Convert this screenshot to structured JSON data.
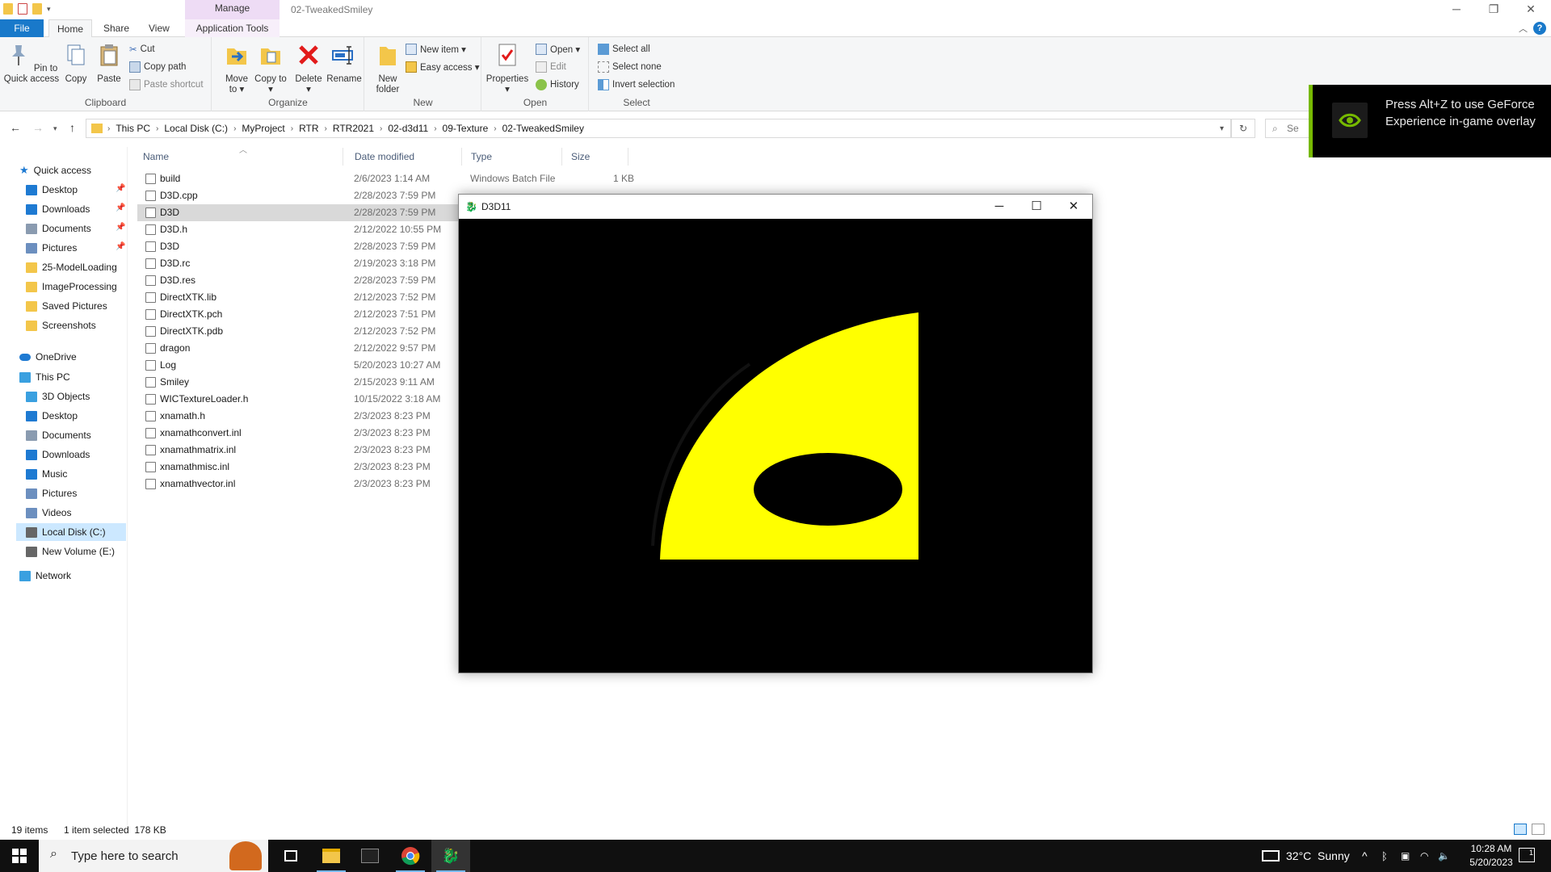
{
  "titlebar": {
    "manage_label": "Manage",
    "window_title": "02-TweakedSmiley",
    "minimize": "─",
    "restore": "❐",
    "close": "✕"
  },
  "ribbon_tabs": {
    "file": "File",
    "home": "Home",
    "share": "Share",
    "view": "View",
    "app_tools": "Application Tools"
  },
  "ribbon": {
    "clipboard": {
      "label": "Clipboard",
      "pin": "Pin to Quick access",
      "copy": "Copy",
      "paste": "Paste",
      "cut": "Cut",
      "copy_path": "Copy path",
      "paste_shortcut": "Paste shortcut"
    },
    "organize": {
      "label": "Organize",
      "move_to": "Move to ▾",
      "copy_to": "Copy to ▾",
      "delete": "Delete ▾",
      "rename": "Rename"
    },
    "new": {
      "label": "New",
      "new_folder": "New folder",
      "new_item": "New item ▾",
      "easy_access": "Easy access ▾"
    },
    "open": {
      "label": "Open",
      "properties": "Properties ▾",
      "open": "Open ▾",
      "edit": "Edit",
      "history": "History"
    },
    "select": {
      "label": "Select",
      "select_all": "Select all",
      "select_none": "Select none",
      "invert": "Invert selection"
    }
  },
  "address": {
    "crumbs": [
      "This PC",
      "Local Disk (C:)",
      "MyProject",
      "RTR",
      "RTR2021",
      "02-d3d11",
      "09-Texture",
      "02-TweakedSmiley"
    ],
    "search_placeholder": "Se"
  },
  "nav": {
    "quick_access": "Quick access",
    "quick_items": [
      {
        "label": "Desktop",
        "pinned": true,
        "color": "#1e7ad2"
      },
      {
        "label": "Downloads",
        "pinned": true,
        "color": "#1e7ad2"
      },
      {
        "label": "Documents",
        "pinned": true,
        "color": "#8a9bb0"
      },
      {
        "label": "Pictures",
        "pinned": true,
        "color": "#6c8fbf"
      },
      {
        "label": "25-ModelLoading",
        "pinned": false,
        "color": "#f3c64a"
      },
      {
        "label": "ImageProcessing",
        "pinned": false,
        "color": "#f3c64a"
      },
      {
        "label": "Saved Pictures",
        "pinned": false,
        "color": "#f3c64a"
      },
      {
        "label": "Screenshots",
        "pinned": false,
        "color": "#f3c64a"
      }
    ],
    "onedrive": "OneDrive",
    "this_pc": "This PC",
    "pc_items": [
      {
        "label": "3D Objects",
        "color": "#3aa0e0"
      },
      {
        "label": "Desktop",
        "color": "#1e7ad2"
      },
      {
        "label": "Documents",
        "color": "#8a9bb0"
      },
      {
        "label": "Downloads",
        "color": "#1e7ad2"
      },
      {
        "label": "Music",
        "color": "#1e7ad2"
      },
      {
        "label": "Pictures",
        "color": "#6c8fbf"
      },
      {
        "label": "Videos",
        "color": "#6c8fbf"
      },
      {
        "label": "Local Disk (C:)",
        "color": "#666",
        "selected": true
      },
      {
        "label": "New Volume (E:)",
        "color": "#666"
      }
    ],
    "network": "Network"
  },
  "columns": {
    "name": "Name",
    "date": "Date modified",
    "type": "Type",
    "size": "Size"
  },
  "files": [
    {
      "name": "build",
      "date": "2/6/2023 1:14 AM",
      "type": "Windows Batch File",
      "size": "1 KB"
    },
    {
      "name": "D3D.cpp",
      "date": "2/28/2023 7:59 PM",
      "type": "",
      "size": ""
    },
    {
      "name": "D3D",
      "date": "2/28/2023 7:59 PM",
      "type": "",
      "size": "",
      "selected": true
    },
    {
      "name": "D3D.h",
      "date": "2/12/2022 10:55 PM",
      "type": "",
      "size": ""
    },
    {
      "name": "D3D",
      "date": "2/28/2023 7:59 PM",
      "type": "",
      "size": ""
    },
    {
      "name": "D3D.rc",
      "date": "2/19/2023 3:18 PM",
      "type": "",
      "size": ""
    },
    {
      "name": "D3D.res",
      "date": "2/28/2023 7:59 PM",
      "type": "",
      "size": ""
    },
    {
      "name": "DirectXTK.lib",
      "date": "2/12/2023 7:52 PM",
      "type": "",
      "size": ""
    },
    {
      "name": "DirectXTK.pch",
      "date": "2/12/2023 7:51 PM",
      "type": "",
      "size": ""
    },
    {
      "name": "DirectXTK.pdb",
      "date": "2/12/2023 7:52 PM",
      "type": "",
      "size": ""
    },
    {
      "name": "dragon",
      "date": "2/12/2022 9:57 PM",
      "type": "",
      "size": ""
    },
    {
      "name": "Log",
      "date": "5/20/2023 10:27 AM",
      "type": "",
      "size": ""
    },
    {
      "name": "Smiley",
      "date": "2/15/2023 9:11 AM",
      "type": "",
      "size": ""
    },
    {
      "name": "WICTextureLoader.h",
      "date": "10/15/2022 3:18 AM",
      "type": "",
      "size": ""
    },
    {
      "name": "xnamath.h",
      "date": "2/3/2023 8:23 PM",
      "type": "",
      "size": ""
    },
    {
      "name": "xnamathconvert.inl",
      "date": "2/3/2023 8:23 PM",
      "type": "",
      "size": ""
    },
    {
      "name": "xnamathmatrix.inl",
      "date": "2/3/2023 8:23 PM",
      "type": "",
      "size": ""
    },
    {
      "name": "xnamathmisc.inl",
      "date": "2/3/2023 8:23 PM",
      "type": "",
      "size": ""
    },
    {
      "name": "xnamathvector.inl",
      "date": "2/3/2023 8:23 PM",
      "type": "",
      "size": ""
    }
  ],
  "status": {
    "count": "19 items",
    "selection": "1 item selected  178 KB"
  },
  "d3d": {
    "title": "D3D11",
    "minimize": "─",
    "maximize": "☐",
    "close": "✕",
    "shape_color": "#ffff00",
    "background": "#000000"
  },
  "geforce": {
    "message": "Press Alt+Z to use GeForce Experience in-game overlay",
    "accent": "#76b900"
  },
  "taskbar": {
    "search_placeholder": "Type here to search",
    "weather": "32°C  Sunny",
    "time": "10:28 AM",
    "date": "5/20/2023",
    "notif_count": "1"
  }
}
